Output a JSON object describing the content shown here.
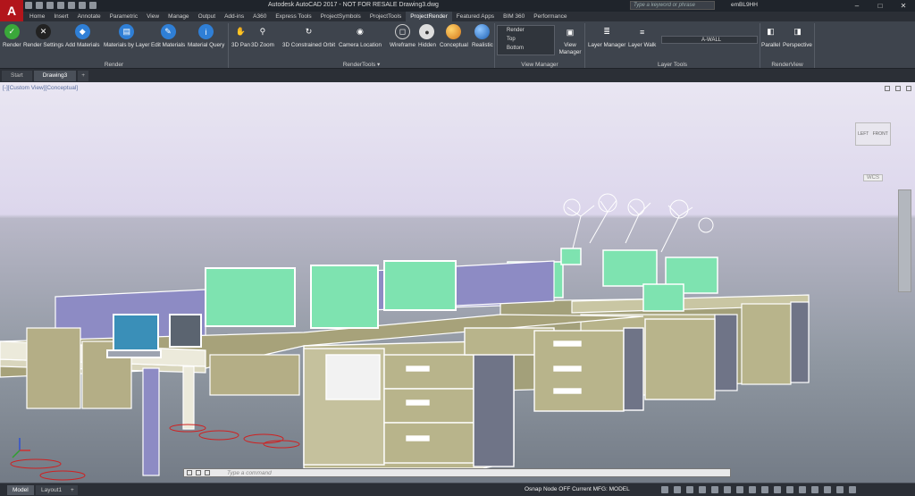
{
  "app": {
    "logo_letter": "A",
    "title": "Autodesk AutoCAD 2017 - NOT FOR RESALE    Drawing3.dwg",
    "search_placeholder": "Type a keyword or phrase",
    "user": "emBL9HH"
  },
  "tabs": [
    "Home",
    "Insert",
    "Annotate",
    "Parametric",
    "View",
    "Manage",
    "Output",
    "Add-ins",
    "A360",
    "Express Tools",
    "ProjectSymbols",
    "ProjectTools",
    "ProjectRender",
    "Featured Apps",
    "BIM 360",
    "Performance"
  ],
  "ribbon": {
    "render": {
      "panel_label": "Render",
      "buttons": [
        "Render",
        "Render Settings",
        "Add Materials",
        "Materials by Layer",
        "Edit Materials",
        "Material Query"
      ]
    },
    "rendertools": {
      "panel_label": "RenderTools ▾",
      "buttons": [
        "3D Pan",
        "3D Zoom",
        "3D Constrained Orbit",
        "Camera Location",
        "Wireframe",
        "Hidden",
        "Conceptual",
        "Realistic"
      ]
    },
    "viewmanager": {
      "panel_label": "View Manager",
      "views": [
        "Render",
        "Top",
        "Bottom"
      ],
      "button": "View Manager"
    },
    "layertools": {
      "panel_label": "Layer Tools",
      "buttons": [
        "Layer Manager",
        "Layer Walk"
      ],
      "layer_name": "A-WALL"
    },
    "renderview": {
      "panel_label": "RenderView",
      "buttons": [
        "Parallel",
        "Perspective"
      ]
    }
  },
  "doc_tabs": [
    "Start",
    "Drawing3"
  ],
  "viewport": {
    "label": "[-][Custom View][Conceptual]",
    "cube_left": "LEFT",
    "cube_front": "FRONT",
    "wcs": "WCS"
  },
  "command": {
    "placeholder": "Type a command"
  },
  "status": {
    "layout_tabs": [
      "Model",
      "Layout1"
    ],
    "text": "Osnap Node OFF   Current MFG:   MODEL"
  }
}
